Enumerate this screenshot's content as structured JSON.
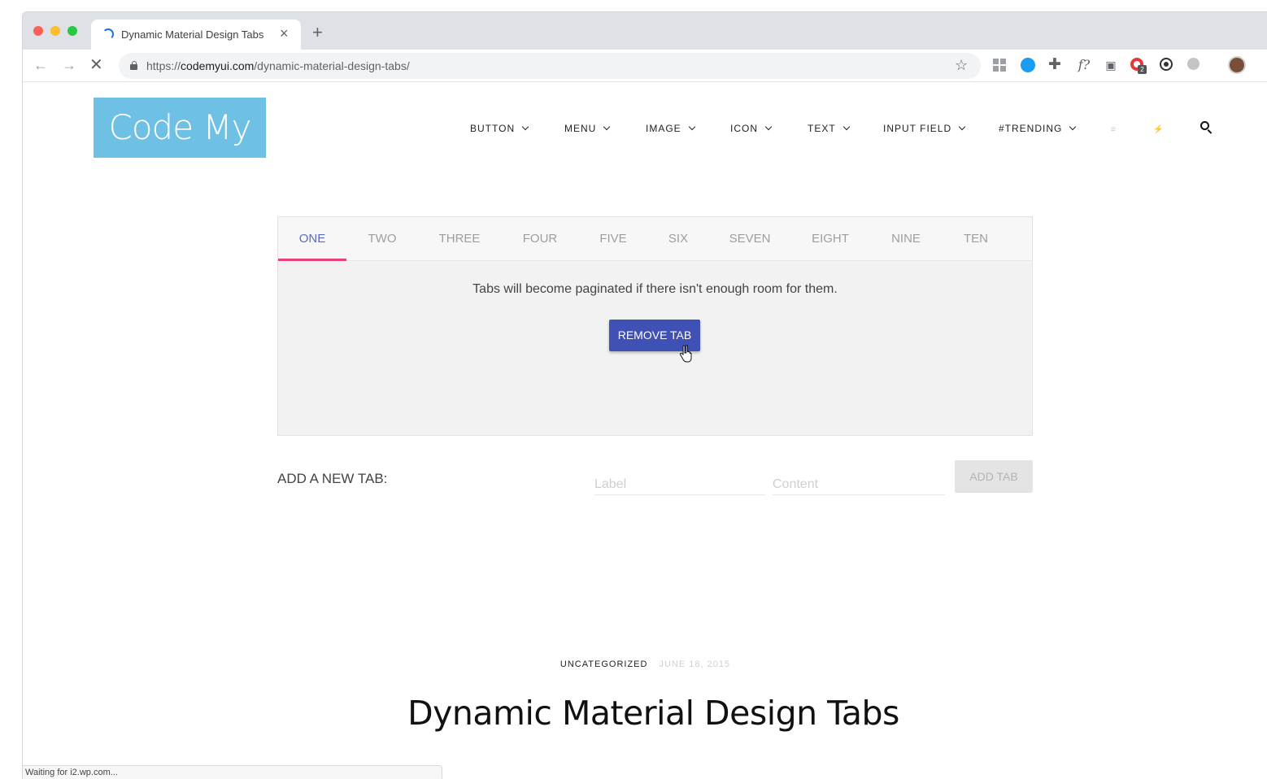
{
  "browser": {
    "tab_title": "Dynamic Material Design Tabs",
    "new_tab_symbol": "+",
    "close_symbol": "×",
    "url_scheme": "https://",
    "url_host": "codemyui.com",
    "url_path": "/dynamic-material-design-tabs/",
    "status_text": "Waiting for i2.wp.com...",
    "icons": [
      "back-arrow-icon",
      "forward-arrow-icon",
      "stop-loading-icon",
      "lock-icon",
      "bookmark-star-icon",
      "menu-kebab-icon"
    ],
    "extension_badge": "2"
  },
  "site": {
    "logo_text": "Code My UI",
    "nav": [
      {
        "label": "BUTTON"
      },
      {
        "label": "MENU"
      },
      {
        "label": "IMAGE"
      },
      {
        "label": "ICON"
      },
      {
        "label": "TEXT"
      },
      {
        "label": "INPUT FIELD"
      },
      {
        "label": "#TRENDING"
      }
    ],
    "nav_icon_1": "≡",
    "nav_icon_2": "⚡"
  },
  "demo": {
    "tabs": [
      "ONE",
      "TWO",
      "THREE",
      "FOUR",
      "FIVE",
      "SIX",
      "SEVEN",
      "EIGHT",
      "NINE",
      "TEN"
    ],
    "active_tab": "ONE",
    "content_text": "Tabs will become paginated if there isn't enough room for them.",
    "remove_button": "REMOVE TAB",
    "add_label": "ADD A NEW TAB:",
    "label_placeholder": "Label",
    "content_placeholder": "Content",
    "add_button": "ADD TAB",
    "colors": {
      "active_tab": "#5c6bc0",
      "indicator": "#ec407a",
      "button": "#3f51b5"
    }
  },
  "post": {
    "category": "UNCATEGORIZED",
    "date": "JUNE 18, 2015",
    "title": "Dynamic Material Design Tabs"
  }
}
